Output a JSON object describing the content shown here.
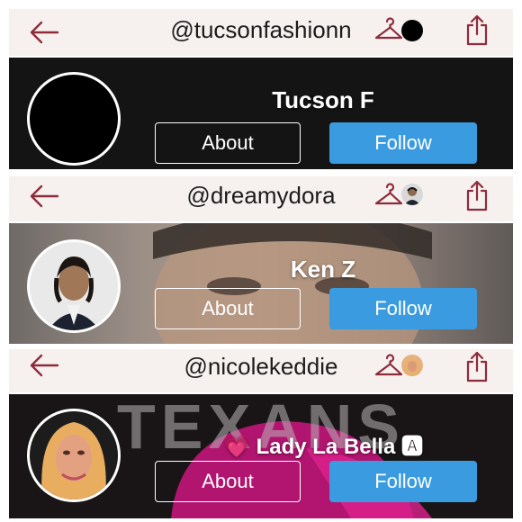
{
  "colors": {
    "accent": "#3a9be0",
    "icon": "#8e2b3b",
    "bar": "#f6f1ee"
  },
  "profiles": [
    {
      "username": "@tucsonfashionn",
      "display_name": "Tucson F",
      "about_label": "About",
      "follow_label": "Follow",
      "icons": [
        "back-arrow-icon",
        "hanger-icon",
        "share-icon"
      ]
    },
    {
      "username": "@dreamydora",
      "display_name": "Ken Z",
      "about_label": "About",
      "follow_label": "Follow",
      "icons": [
        "back-arrow-icon",
        "hanger-icon",
        "share-icon"
      ]
    },
    {
      "username": "@nicolekeddie",
      "display_name": "💗 Lady La Bella 🅰",
      "banner_text": "TEXANS",
      "about_label": "About",
      "follow_label": "Follow",
      "icons": [
        "back-arrow-icon",
        "hanger-icon",
        "share-icon"
      ]
    }
  ]
}
